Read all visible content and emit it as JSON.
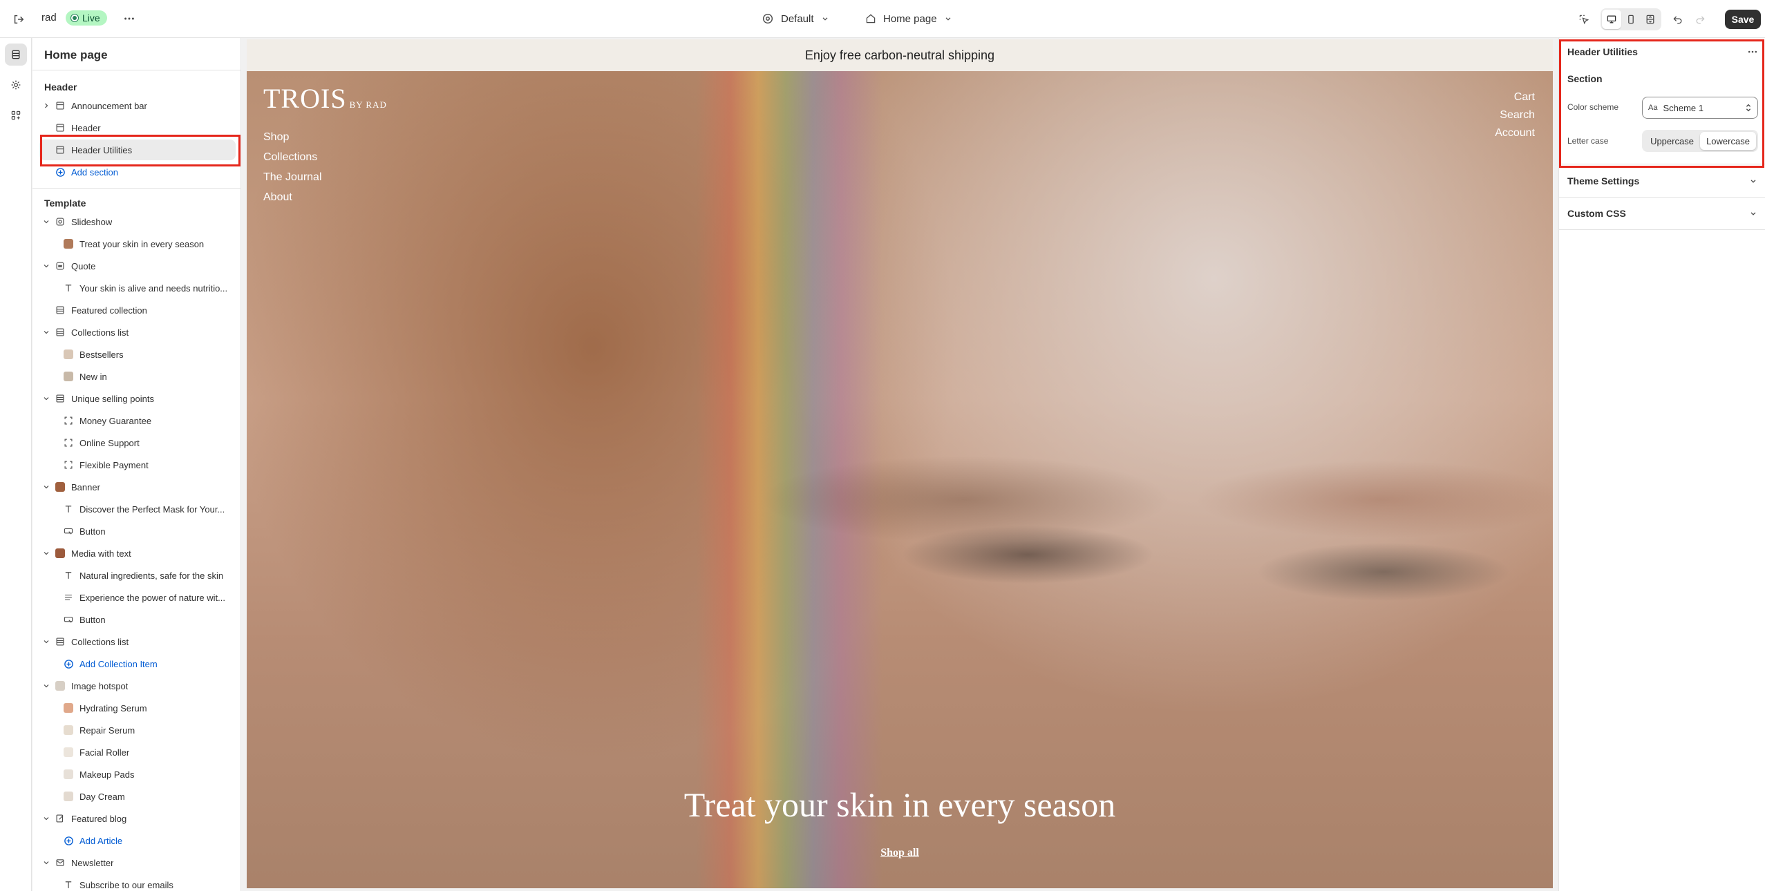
{
  "topbar": {
    "store_name": "rad",
    "status_badge": "Live",
    "theme_selector": "Default",
    "page_selector": "Home page",
    "save_label": "Save"
  },
  "left_panel": {
    "title": "Home page",
    "header_group": {
      "label": "Header",
      "items": [
        {
          "label": "Announcement bar"
        },
        {
          "label": "Header"
        },
        {
          "label": "Header Utilities"
        }
      ],
      "add_label": "Add section"
    },
    "template_group": {
      "label": "Template",
      "items": [
        {
          "label": "Slideshow"
        },
        {
          "label": "Treat your skin in every season"
        },
        {
          "label": "Quote"
        },
        {
          "label": "Your skin is alive and needs nutritio..."
        },
        {
          "label": "Featured collection"
        },
        {
          "label": "Collections list"
        },
        {
          "label": "Bestsellers"
        },
        {
          "label": "New in"
        },
        {
          "label": "Unique selling points"
        },
        {
          "label": "Money Guarantee"
        },
        {
          "label": "Online Support"
        },
        {
          "label": "Flexible Payment"
        },
        {
          "label": "Banner"
        },
        {
          "label": "Discover the Perfect Mask for Your..."
        },
        {
          "label": "Button"
        },
        {
          "label": "Media with text"
        },
        {
          "label": "Natural ingredients, safe for the skin"
        },
        {
          "label": "Experience the power of nature wit..."
        },
        {
          "label": "Button"
        },
        {
          "label": "Collections list"
        },
        {
          "label": "Add Collection Item"
        },
        {
          "label": "Image hotspot"
        },
        {
          "label": "Hydrating Serum"
        },
        {
          "label": "Repair Serum"
        },
        {
          "label": "Facial Roller"
        },
        {
          "label": "Makeup Pads"
        },
        {
          "label": "Day Cream"
        },
        {
          "label": "Featured blog"
        },
        {
          "label": "Add Article"
        },
        {
          "label": "Newsletter"
        },
        {
          "label": "Subscribe to our emails"
        }
      ]
    }
  },
  "preview": {
    "announcement": "Enjoy free carbon-neutral shipping",
    "logo": "TROIS",
    "logo_sub": "BY RAD",
    "nav": [
      "Shop",
      "Collections",
      "The Journal",
      "About"
    ],
    "utility_links": [
      "Cart",
      "Search",
      "Account"
    ],
    "headline": "Treat your skin in every season",
    "cta": "Shop all"
  },
  "right_panel": {
    "title": "Header Utilities",
    "section_label": "Section",
    "color_scheme_label": "Color scheme",
    "color_scheme_value": "Scheme 1",
    "color_scheme_icon": "Aa",
    "letter_case_label": "Letter case",
    "letter_case_options": [
      "Uppercase",
      "Lowercase"
    ],
    "letter_case_selected": "Lowercase",
    "collapsibles": [
      "Theme Settings",
      "Custom CSS"
    ]
  },
  "colors": {
    "highlight": "#e5261b",
    "live_badge_bg": "#b4f6c2",
    "link_blue": "#005bd3"
  }
}
